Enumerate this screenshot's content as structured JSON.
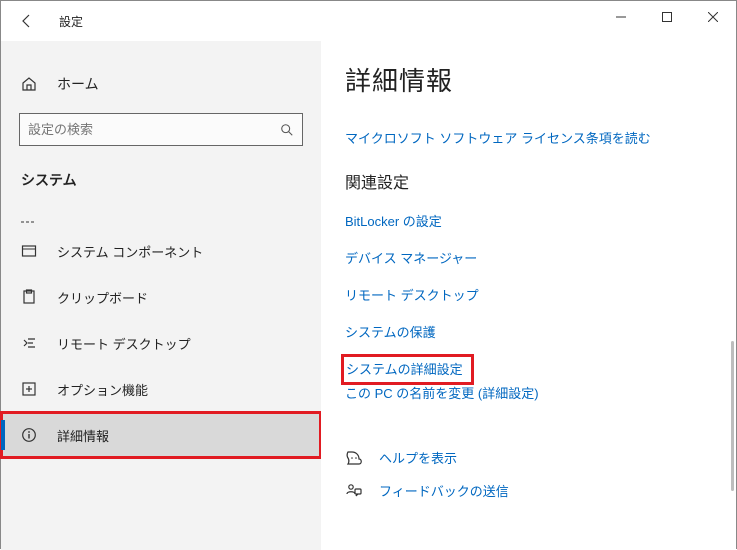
{
  "titlebar": {
    "title": "設定"
  },
  "sidebar": {
    "home": "ホーム",
    "search_placeholder": "設定の検索",
    "section": "システム",
    "truncated_item": "",
    "items": [
      {
        "label": "システム コンポーネント"
      },
      {
        "label": "クリップボード"
      },
      {
        "label": "リモート デスクトップ"
      },
      {
        "label": "オプション機能"
      },
      {
        "label": "詳細情報"
      }
    ]
  },
  "main": {
    "title": "詳細情報",
    "license_link": "マイクロソフト ソフトウェア ライセンス条項を読む",
    "related_heading": "関連設定",
    "links": {
      "bitlocker": "BitLocker の設定",
      "devmgr": "デバイス マネージャー",
      "rdp": "リモート デスクトップ",
      "protect": "システムの保護",
      "advanced": "システムの詳細設定",
      "rename": "この PC の名前を変更 (詳細設定)"
    },
    "help": "ヘルプを表示",
    "feedback": "フィードバックの送信"
  }
}
